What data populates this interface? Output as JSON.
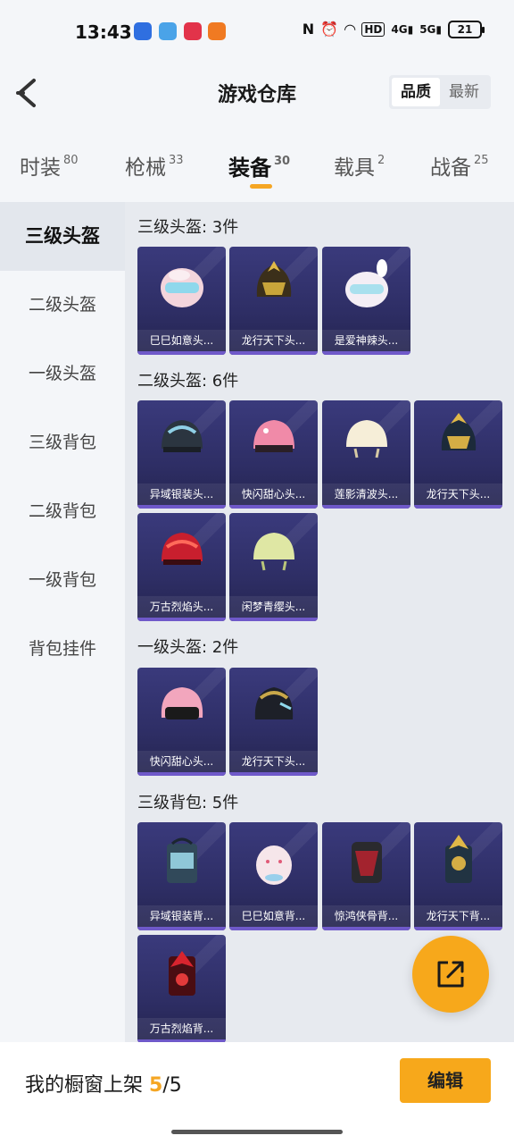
{
  "status_bar": {
    "time": "13:43",
    "network_4g": "4G",
    "network_5g": "5G",
    "hd": "HD",
    "battery": "21"
  },
  "header": {
    "title": "游戏仓库",
    "sort_options": [
      "品质",
      "最新"
    ],
    "sort_active": "品质"
  },
  "tabs": [
    {
      "label": "时装",
      "count": "80"
    },
    {
      "label": "枪械",
      "count": "33"
    },
    {
      "label": "装备",
      "count": "30",
      "active": true
    },
    {
      "label": "载具",
      "count": "2"
    },
    {
      "label": "战备",
      "count": "25"
    }
  ],
  "sidenav": [
    "三级头盔",
    "二级头盔",
    "一级头盔",
    "三级背包",
    "二级背包",
    "一级背包",
    "背包挂件"
  ],
  "sections": [
    {
      "title": "三级头盔: 3件",
      "items": [
        "巳巳如意头...",
        "龙行天下头...",
        "是爱神辣头..."
      ]
    },
    {
      "title": "二级头盔: 6件",
      "items": [
        "异域银装头...",
        "快闪甜心头...",
        "莲影清波头...",
        "龙行天下头...",
        "万古烈焰头...",
        "闲梦青缨头..."
      ]
    },
    {
      "title": "一级头盔: 2件",
      "items": [
        "快闪甜心头...",
        "龙行天下头..."
      ]
    },
    {
      "title": "三级背包: 5件",
      "items": [
        "异域银装背...",
        "巳巳如意背...",
        "惊鸿侠骨背...",
        "龙行天下背...",
        "万古烈焰背..."
      ]
    }
  ],
  "footer": {
    "label": "我的橱窗上架",
    "current": "5",
    "separator": "/",
    "total": "5",
    "edit_label": "编辑"
  },
  "colors": {
    "accent": "#f7a81b",
    "card_bg": "#2e2e65",
    "card_bar": "#6f59c9"
  }
}
